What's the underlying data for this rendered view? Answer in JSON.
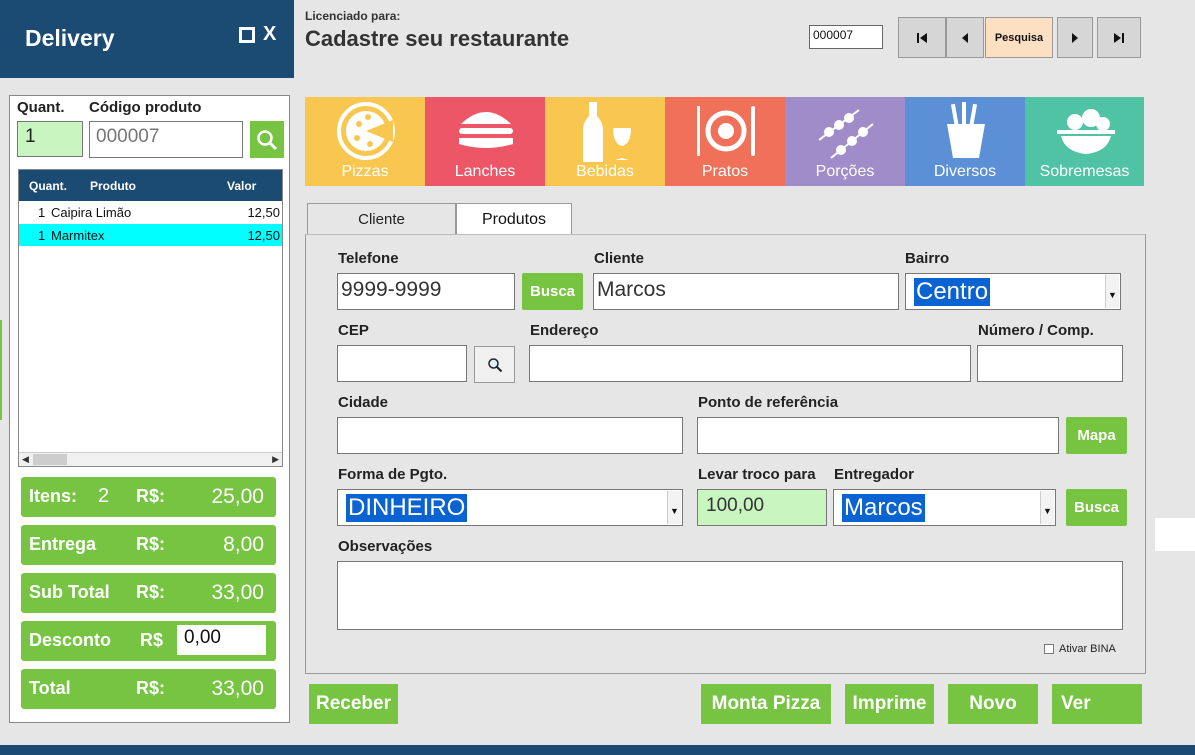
{
  "app": {
    "title": "Delivery",
    "window": {
      "maximize_icon": "square-icon",
      "close_label": "X"
    }
  },
  "header": {
    "license_label": "Licenciado para:",
    "license_name": "Cadastre seu restaurante",
    "record_code": "000007",
    "nav": {
      "first": "⏮",
      "prev": "◀",
      "search": "Pesquisa",
      "next": "▶",
      "last": "⏭"
    }
  },
  "order": {
    "qty_label": "Quant.",
    "code_label": "Código produto",
    "qty_value": "1",
    "code_value": "000007",
    "grid": {
      "columns": [
        "Quant.",
        "Produto",
        "Valor"
      ],
      "rows": [
        {
          "qty": "1",
          "product": "Caipira Limão",
          "value": "12,50",
          "selected": false
        },
        {
          "qty": "1",
          "product": "Marmitex",
          "value": "12,50",
          "selected": true
        }
      ]
    },
    "totals": {
      "items_label": "Itens:",
      "items_count": "2",
      "items_currency": "R$:",
      "items_value": "25,00",
      "delivery_label": "Entrega",
      "delivery_currency": "R$:",
      "delivery_value": "8,00",
      "subtotal_label": "Sub Total",
      "subtotal_currency": "R$:",
      "subtotal_value": "33,00",
      "discount_label": "Desconto",
      "discount_currency": "R$",
      "discount_value": "0,00",
      "total_label": "Total",
      "total_currency": "R$:",
      "total_value": "33,00"
    }
  },
  "categories": [
    {
      "name": "Pizzas",
      "color": "#f9c74f",
      "icon": "pizza-icon"
    },
    {
      "name": "Lanches",
      "color": "#ec5667",
      "icon": "burger-icon"
    },
    {
      "name": "Bebidas",
      "color": "#f9c74f",
      "icon": "drinks-icon"
    },
    {
      "name": "Pratos",
      "color": "#f0705a",
      "icon": "plate-icon"
    },
    {
      "name": "Porções",
      "color": "#a08cc8",
      "icon": "skewer-icon"
    },
    {
      "name": "Diversos",
      "color": "#5b8fd6",
      "icon": "fries-icon"
    },
    {
      "name": "Sobremesas",
      "color": "#4fc3a4",
      "icon": "fruit-bowl-icon"
    }
  ],
  "tabs": {
    "cliente": "Cliente",
    "produtos": "Produtos"
  },
  "form": {
    "telefone_label": "Telefone",
    "telefone_value": "9999-9999",
    "busca_label": "Busca",
    "cliente_label": "Cliente",
    "cliente_value": "Marcos",
    "bairro_label": "Bairro",
    "bairro_value": "Centro",
    "cep_label": "CEP",
    "cep_value": "",
    "endereco_label": "Endereço",
    "endereco_value": "",
    "numero_label": "Número / Comp.",
    "numero_value": "",
    "cidade_label": "Cidade",
    "cidade_value": "",
    "ponto_label": "Ponto de referência",
    "ponto_value": "",
    "mapa_label": "Mapa",
    "pagto_label": "Forma de Pgto.",
    "pagto_value": "DINHEIRO",
    "troco_label": "Levar troco para",
    "troco_value": "100,00",
    "entregador_label": "Entregador",
    "entregador_value": "Marcos",
    "busca2_label": "Busca",
    "obs_label": "Observações",
    "obs_value": "",
    "bina_label": "Ativar BINA"
  },
  "actions": {
    "receber": "Receber",
    "monta_pizza": "Monta Pizza",
    "imprime": "Imprime",
    "novo": "Novo",
    "ver": "Ver"
  },
  "colors": {
    "brand": "#1b4a72",
    "accent_green": "#76c442",
    "selection": "#00ffff"
  }
}
